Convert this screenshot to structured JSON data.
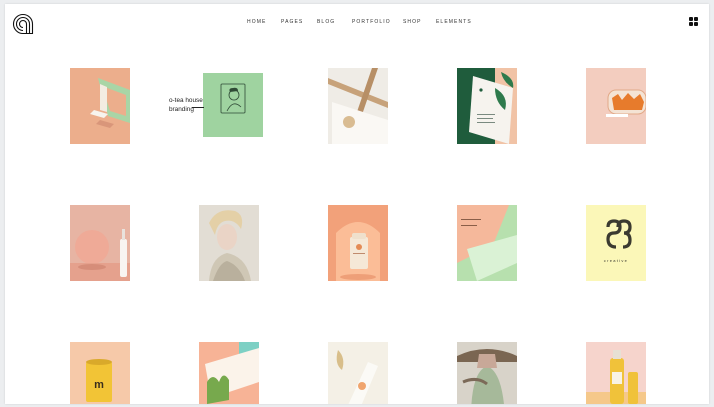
{
  "nav": {
    "items": [
      {
        "label": "HOME"
      },
      {
        "label": "PAGES"
      },
      {
        "label": "BLOG"
      },
      {
        "label": "PORTFOLIO"
      },
      {
        "label": "SHOP"
      },
      {
        "label": "ELEMENTS"
      }
    ]
  },
  "hover_caption": {
    "line1": "o-tea house",
    "line2": "branding"
  },
  "tiles": {
    "t14": {
      "logo_text": "creative"
    },
    "t17": {
      "letter": "m"
    }
  },
  "colors": {
    "peach": "#efb393",
    "mint": "#9fd3a0",
    "green_dark": "#1f5c3c",
    "cream": "#fbf7b8",
    "yellow": "#f2c436"
  },
  "icons": [
    "logo-icon",
    "grid-icon"
  ]
}
